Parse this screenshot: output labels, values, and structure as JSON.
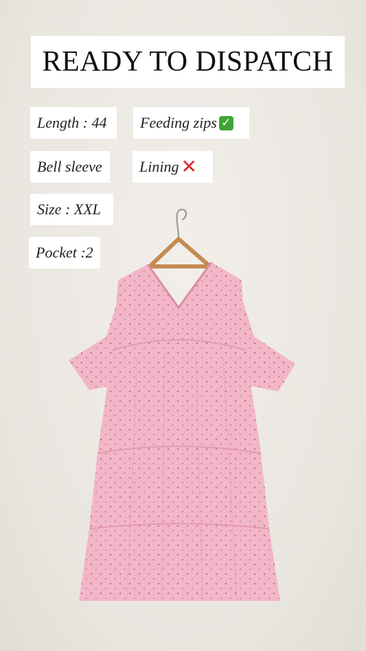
{
  "title": "READY TO DISPATCH",
  "tags": {
    "length": "Length : 44",
    "feeding_zips": "Feeding zips",
    "bell_sleeve": "Bell sleeve",
    "lining": "Lining",
    "size": "Size : XXL",
    "pocket": "Pocket :2"
  },
  "icons": {
    "feeding_zips": "check-mark-icon",
    "lining": "cross-mark-icon"
  },
  "colors": {
    "background": "#ede9e4",
    "dress": "#f3b6c8",
    "check": "#3fa535",
    "cross": "#e1242b"
  }
}
